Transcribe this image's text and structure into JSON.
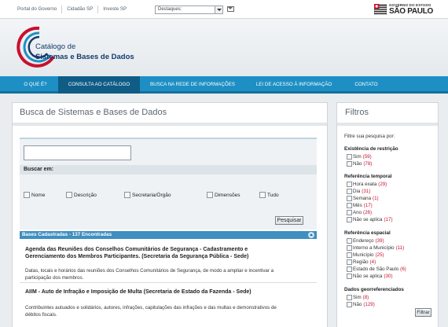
{
  "topbar": {
    "links": [
      "Portal do Governo",
      "Cidadão SP",
      "Investe SP"
    ],
    "destaques_value": "Destaques:",
    "gov_line1": "GOVERNO DO ESTADO",
    "gov_line2": "SÃO PAULO"
  },
  "header": {
    "title_line1": "Catálogo de",
    "title_line2": "Sistemas e Bases de Dados"
  },
  "nav": {
    "items": [
      "O QUE É?",
      "CONSULTA AO CATÁLOGO",
      "BUSCA NA REDE DE INFORMAÇÕES",
      "LEI DE ACESSO À INFORMAÇÃO",
      "CONTATO"
    ],
    "active": "CONSULTA AO CATÁLOGO"
  },
  "search": {
    "title": "Busca de Sistemas e Bases de Dados",
    "input_value": "",
    "search_in_label": "Buscar em:",
    "options": [
      "Nome",
      "Descrição",
      "Secretaria/Órgão",
      "Dimensões",
      "Tudo"
    ],
    "button": "Pesquisar"
  },
  "results": {
    "header": "Bases Cadastradas - 137 Encontradas",
    "items": [
      {
        "title": "Agenda das Reuniões dos Conselhos Comunitários de Segurança - Cadastramento e Gerenciamento dos Membros Participantes.  (Secretaria da Segurança Pública - Sede)",
        "description": "Datas, locais e horários das reuniões dos Conselhos Comunitários de Segurança, de modo a ampliar e incentivar a participação dos membros."
      },
      {
        "title": "AIIM - Auto de Infração e Imposição de Multa  (Secretaria de Estado da Fazenda - Sede)",
        "description": "Contribuintes autuados e solidários, autores, infrações, capitulações das infrações e das multas e demonstrativos de débitos fiscais."
      }
    ]
  },
  "filters": {
    "title": "Filtros",
    "intro": "Filtre sua pesquisa por:",
    "groups": [
      {
        "title": "Existência de restrição",
        "options": [
          {
            "label": "Sim",
            "count": "(59)"
          },
          {
            "label": "Não",
            "count": "(78)"
          }
        ]
      },
      {
        "title": "Referência temporal",
        "options": [
          {
            "label": "Hora exata",
            "count": "(29)"
          },
          {
            "label": "Dia",
            "count": "(31)"
          },
          {
            "label": "Semana",
            "count": "(1)"
          },
          {
            "label": "Mês",
            "count": "(17)"
          },
          {
            "label": "Ano",
            "count": "(26)"
          },
          {
            "label": "Não se aplica",
            "count": "(17)"
          }
        ]
      },
      {
        "title": "Referência espacial",
        "options": [
          {
            "label": "Endereço",
            "count": "(39)"
          },
          {
            "label": "Interno a Município",
            "count": "(11)"
          },
          {
            "label": "Município",
            "count": "(25)"
          },
          {
            "label": "Região",
            "count": "(4)"
          },
          {
            "label": "Estado de São Paulo",
            "count": "(6)"
          },
          {
            "label": "Não se aplica",
            "count": "(30)"
          }
        ]
      },
      {
        "title": "Dados georreferenciados",
        "options": [
          {
            "label": "Sim",
            "count": "(8)"
          },
          {
            "label": "Não",
            "count": "(129)"
          }
        ]
      }
    ],
    "button": "Filtrar"
  },
  "colors": {
    "nav": "#1d8fc4",
    "nav_active": "#0f5c86",
    "brand": "#123a6b",
    "count_red": "#c8102e"
  }
}
